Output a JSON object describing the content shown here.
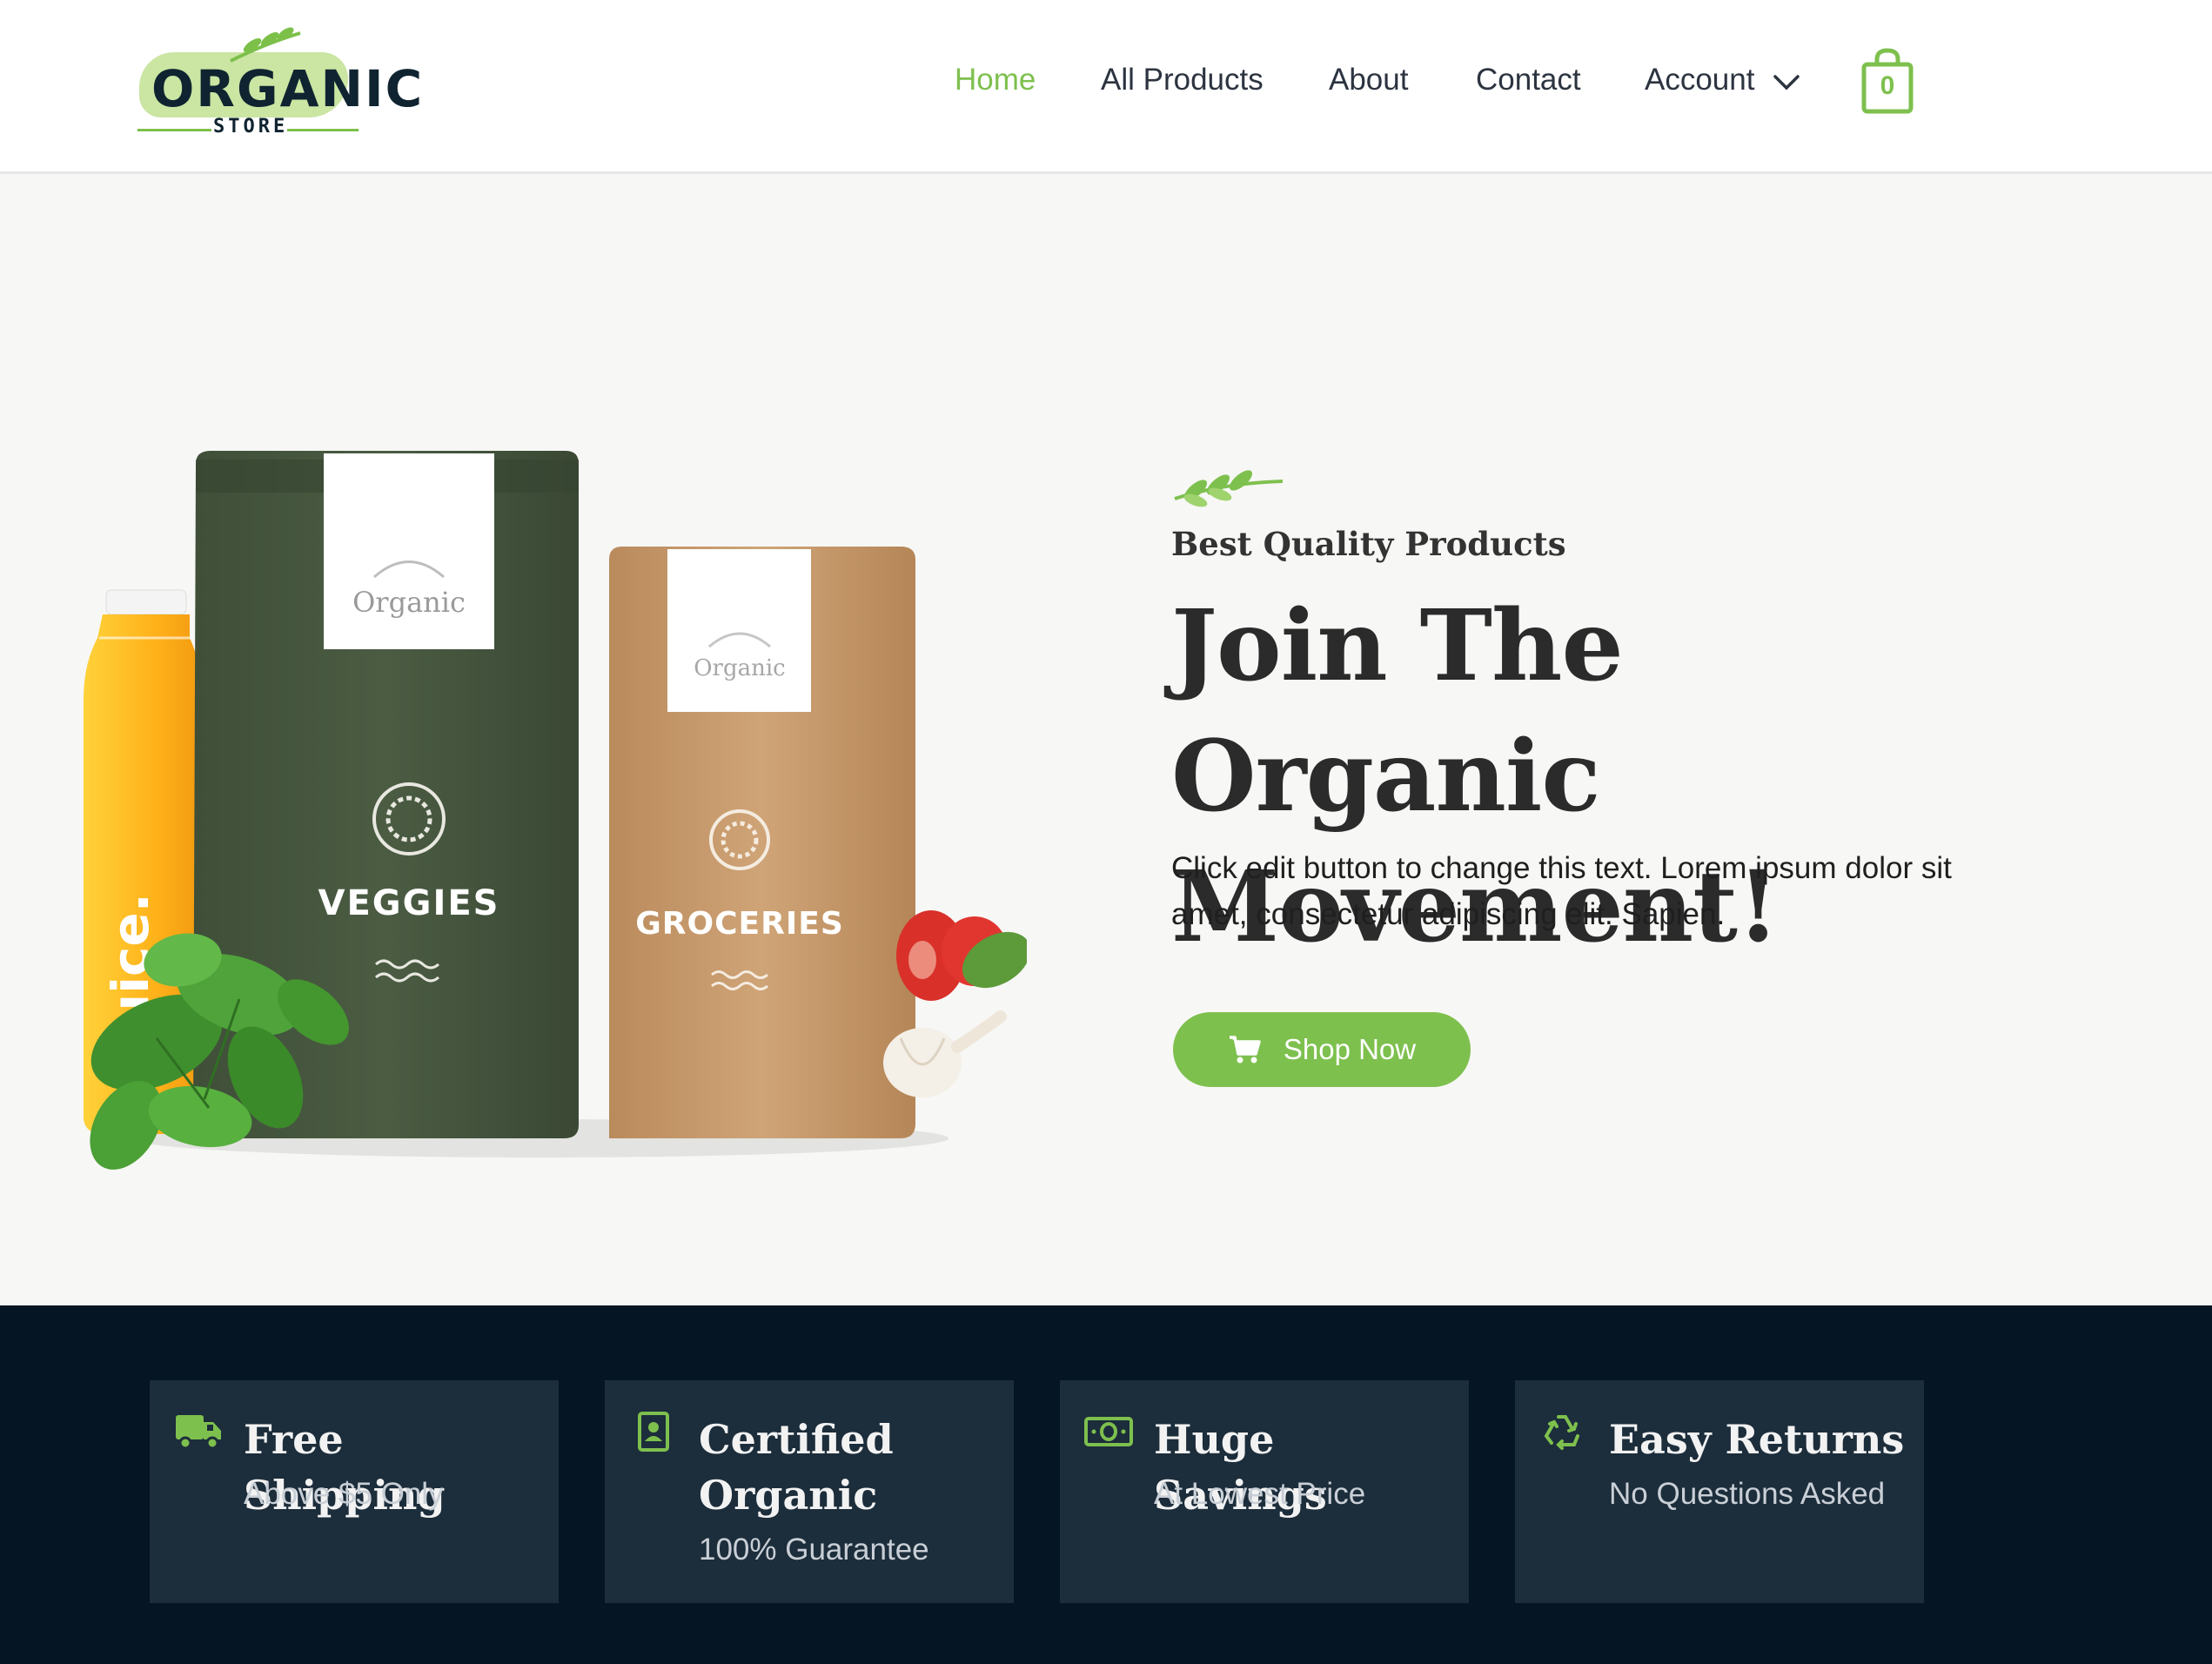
{
  "brand": {
    "logo_main": "ORGANIC",
    "logo_sub": "STORE"
  },
  "nav": {
    "items": [
      {
        "label": "Home",
        "active": true
      },
      {
        "label": "All Products",
        "active": false
      },
      {
        "label": "About",
        "active": false
      },
      {
        "label": "Contact",
        "active": false
      },
      {
        "label": "Account",
        "active": false
      }
    ],
    "cart_count": "0"
  },
  "hero": {
    "eyebrow": "Best Quality Products",
    "title": "Join The Organic Movement!",
    "body": "Click edit button to change this text. Lorem ipsum dolor sit amet, consectetur adipiscing elit. Sapien.",
    "cta_label": "Shop Now",
    "products": {
      "juice_label": "juice.",
      "bag1_brand": "Organic",
      "bag1_label": "VEGGIES",
      "bag2_brand": "Organic",
      "bag2_label": "GROCERIES"
    }
  },
  "features": [
    {
      "icon": "truck-icon",
      "title": "Free Shipping",
      "subtitle": "Above $5 Only"
    },
    {
      "icon": "certificate-icon",
      "title": "Certified Organic",
      "subtitle": "100% Guarantee"
    },
    {
      "icon": "money-icon",
      "title": "Huge Savings",
      "subtitle": "At Lowest Price"
    },
    {
      "icon": "recycle-icon",
      "title": "Easy Returns",
      "subtitle": "No Questions Asked"
    }
  ],
  "colors": {
    "accent_green": "#7ec04e",
    "dark_navy": "#061523",
    "card_navy": "#1c2d3b",
    "bag_green": "#47573f",
    "bag_kraft": "#c89a6c"
  }
}
